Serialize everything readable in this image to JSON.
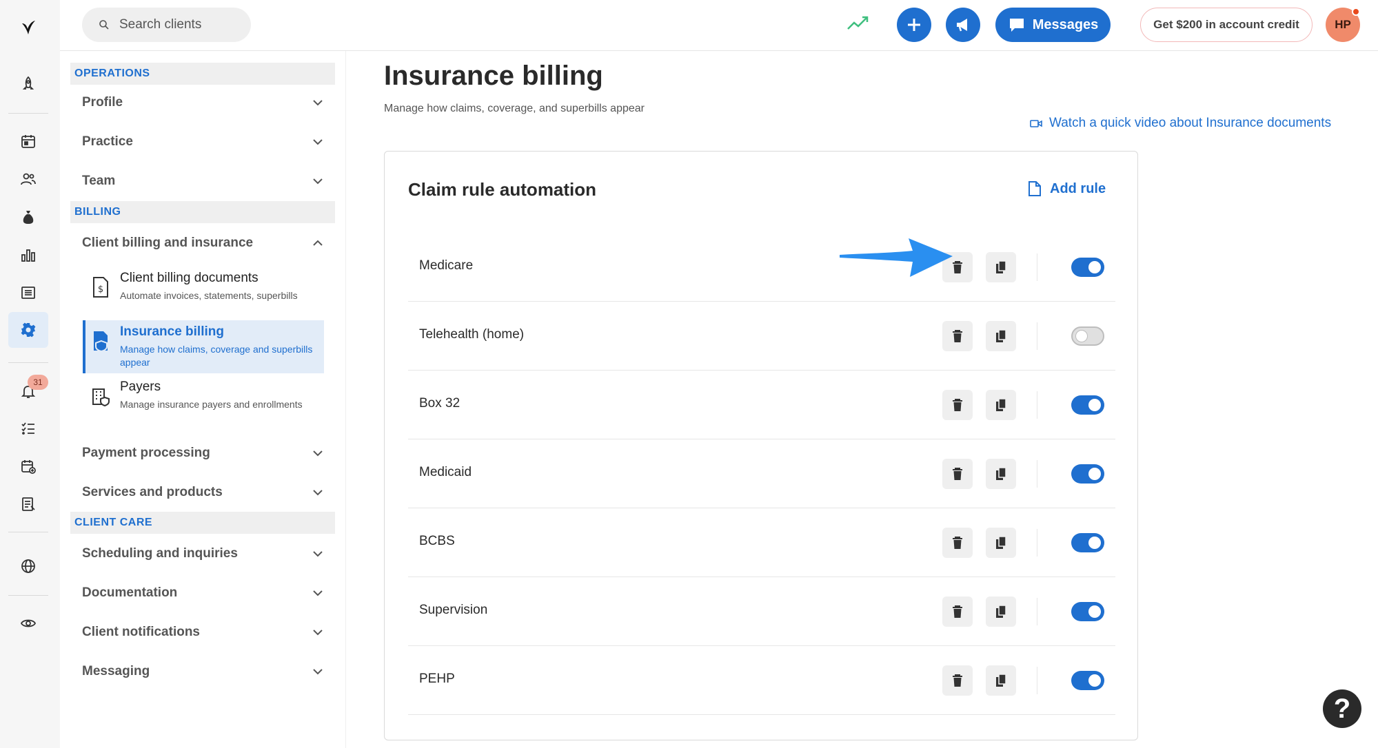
{
  "header": {
    "search": {
      "placeholder": "Search clients"
    },
    "messages_label": "Messages",
    "credit_label": "Get $200 in account credit",
    "avatar_initials": "HP"
  },
  "rail": {
    "notification_count": "31",
    "icons": [
      "logo-icon",
      "rocket-icon",
      "calendar-icon",
      "clients-icon",
      "billing-bag-icon",
      "analytics-icon",
      "list-icon",
      "settings-gear-icon",
      "bell-icon",
      "checklist-icon",
      "calendar-plus-icon",
      "notes-icon",
      "globe-icon",
      "eye-icon"
    ]
  },
  "nav": {
    "sections": {
      "operations": "OPERATIONS",
      "billing": "BILLING",
      "client_care": "CLIENT CARE"
    },
    "items": {
      "profile": "Profile",
      "practice": "Practice",
      "team": "Team",
      "client_billing": "Client billing and insurance",
      "payment_processing": "Payment processing",
      "services_products": "Services and products",
      "scheduling": "Scheduling and inquiries",
      "documentation": "Documentation",
      "client_notifications": "Client notifications",
      "messaging": "Messaging"
    },
    "sub_items": [
      {
        "title": "Client billing documents",
        "desc": "Automate invoices, statements, superbills"
      },
      {
        "title": "Insurance billing",
        "desc": "Manage how claims, coverage and superbills appear"
      },
      {
        "title": "Payers",
        "desc": "Manage insurance payers and enrollments"
      }
    ]
  },
  "main": {
    "title": "Insurance billing",
    "subtitle": "Manage how claims, coverage, and superbills appear",
    "video_link": "Watch a quick video about Insurance documents",
    "card": {
      "title": "Claim rule automation",
      "add_rule": "Add rule",
      "rules": [
        {
          "name": "Medicare",
          "enabled": true
        },
        {
          "name": "Telehealth (home)",
          "enabled": false
        },
        {
          "name": "Box 32",
          "enabled": true
        },
        {
          "name": "Medicaid",
          "enabled": true
        },
        {
          "name": "BCBS",
          "enabled": true
        },
        {
          "name": "Supervision",
          "enabled": true
        },
        {
          "name": "PEHP",
          "enabled": true
        }
      ]
    }
  },
  "help_label": "?",
  "colors": {
    "accent": "#1f6fcf",
    "arrow": "#2a8ff0",
    "avatar": "#f08a6a",
    "trend": "#3fbf7f"
  }
}
